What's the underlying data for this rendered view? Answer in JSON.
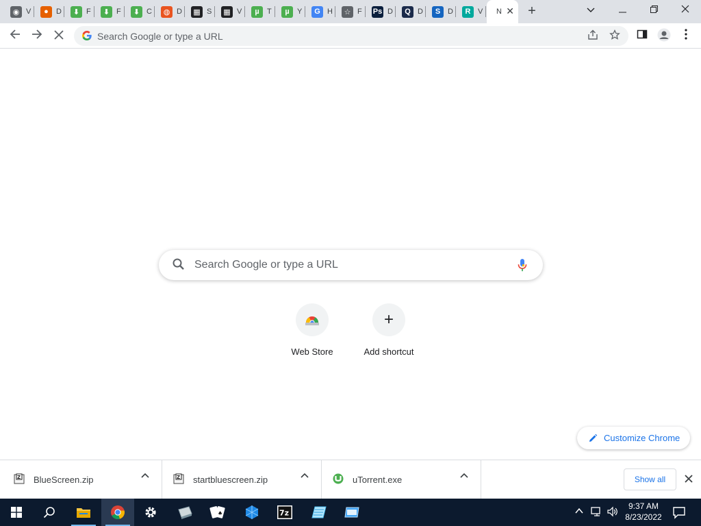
{
  "tabs": [
    {
      "icon": "chrome-icon",
      "title": "V",
      "color": "#5f6368"
    },
    {
      "icon": "firefox-icon",
      "title": "D",
      "color": "#e66000"
    },
    {
      "icon": "download-arrow-icon",
      "title": "F",
      "color": "#4caf50"
    },
    {
      "icon": "download-arrow-icon",
      "title": "F",
      "color": "#4caf50"
    },
    {
      "icon": "download-arrow-icon",
      "title": "C",
      "color": "#4caf50"
    },
    {
      "icon": "ubuntu-icon",
      "title": "D",
      "color": "#e95420"
    },
    {
      "icon": "grid-logo-icon",
      "title": "S",
      "color": "#202124"
    },
    {
      "icon": "grid-logo-icon",
      "title": "V",
      "color": "#202124"
    },
    {
      "icon": "utorrent-icon",
      "title": "T",
      "color": "#4caf50"
    },
    {
      "icon": "utorrent-icon",
      "title": "Y",
      "color": "#4caf50"
    },
    {
      "icon": "google-icon",
      "title": "H",
      "color": "#4285f4"
    },
    {
      "icon": "star-outline-icon",
      "title": "F",
      "color": "#5f6368"
    },
    {
      "icon": "ps-icon",
      "title": "D",
      "color": "#0b1f3d"
    },
    {
      "icon": "q-icon",
      "title": "D",
      "color": "#1a2a4a"
    },
    {
      "icon": "s-logo-icon",
      "title": "D",
      "color": "#1565c0"
    },
    {
      "icon": "r-logo-icon",
      "title": "V",
      "color": "#00a99d"
    }
  ],
  "active_tab": {
    "title": "N",
    "close": "✕"
  },
  "new_tab": "+",
  "window": {
    "chevron": "⌄",
    "minimize": "—",
    "restore": "❐",
    "close": "✕"
  },
  "toolbar": {
    "back": "←",
    "forward": "→",
    "stop": "✕",
    "omnibox_placeholder": "Search Google or type a URL"
  },
  "ntp": {
    "search_placeholder": "Search Google or type a URL",
    "shortcuts": [
      {
        "label": "Web Store"
      },
      {
        "label": "Add shortcut",
        "glyph": "+"
      }
    ],
    "customize_label": "Customize Chrome"
  },
  "downloads": [
    {
      "name": "BlueScreen.zip",
      "icon": "zip-file-icon"
    },
    {
      "name": "startbluescreen.zip",
      "icon": "zip-file-icon"
    },
    {
      "name": "uTorrent.exe",
      "icon": "utorrent-icon"
    }
  ],
  "shelf": {
    "show_all": "Show all",
    "close": "✕",
    "chevron": "∧"
  },
  "taskbar": {
    "time": "9:37 AM",
    "date": "8/23/2022"
  },
  "colors": {
    "accent": "#1a73e8",
    "tabstrip": "#dee1e6",
    "taskbar": "#0c1a2e"
  }
}
